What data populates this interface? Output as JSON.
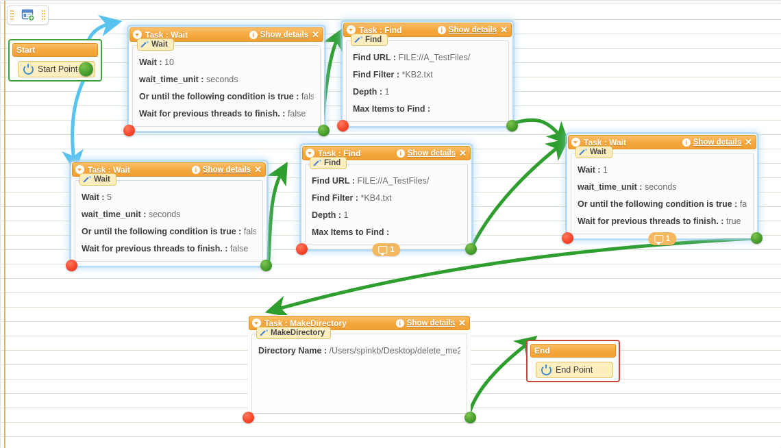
{
  "toolbar": {
    "add_task_icon": "add-form-icon",
    "grip_icon": "drag-grip-icon"
  },
  "nodes": {
    "start": {
      "title": "Start",
      "button_label": "Start Point",
      "power_icon": "power-icon"
    },
    "end": {
      "title": "End",
      "button_label": "End Point",
      "power_icon": "power-icon"
    }
  },
  "common": {
    "show_details": "Show details",
    "info_icon": "info-icon",
    "close_icon": "close-icon",
    "collapse_icon": "collapse-chevron-icon",
    "wand_icon": "wand-icon",
    "comment_icon": "comment-bubble-icon"
  },
  "tasks": [
    {
      "id": "wait-10",
      "header": "Task : Wait",
      "type_tab": "Wait",
      "rows": [
        {
          "label": "Wait :",
          "value": "10"
        },
        {
          "label": "wait_time_unit :",
          "value": "seconds"
        },
        {
          "label": "Or until the following condition is true :",
          "value": "false"
        },
        {
          "label": "Wait for previous threads to finish. :",
          "value": "false"
        }
      ],
      "badge": null
    },
    {
      "id": "find-kb2",
      "header": "Task : Find",
      "type_tab": "Find",
      "rows": [
        {
          "label": "Find URL :",
          "value": "FILE://A_TestFiles/"
        },
        {
          "label": "Find Filter :",
          "value": "*KB2.txt"
        },
        {
          "label": "Depth :",
          "value": "1"
        },
        {
          "label": "Max Items to Find :",
          "value": ""
        }
      ],
      "badge": null
    },
    {
      "id": "wait-5",
      "header": "Task : Wait",
      "type_tab": "Wait",
      "rows": [
        {
          "label": "Wait :",
          "value": "5"
        },
        {
          "label": "wait_time_unit :",
          "value": "seconds"
        },
        {
          "label": "Or until the following condition is true :",
          "value": "false"
        },
        {
          "label": "Wait for previous threads to finish. :",
          "value": "false"
        }
      ],
      "badge": null
    },
    {
      "id": "find-kb4",
      "header": "Task : Find",
      "type_tab": "Find",
      "rows": [
        {
          "label": "Find URL :",
          "value": "FILE://A_TestFiles/"
        },
        {
          "label": "Find Filter :",
          "value": "*KB4.txt"
        },
        {
          "label": "Depth :",
          "value": "1"
        },
        {
          "label": "Max Items to Find :",
          "value": ""
        }
      ],
      "badge": "1"
    },
    {
      "id": "wait-1",
      "header": "Task : Wait",
      "type_tab": "Wait",
      "rows": [
        {
          "label": "Wait :",
          "value": "1"
        },
        {
          "label": "wait_time_unit :",
          "value": "seconds"
        },
        {
          "label": "Or until the following condition is true :",
          "value": "false"
        },
        {
          "label": "Wait for previous threads to finish. :",
          "value": "true"
        }
      ],
      "badge": "1"
    },
    {
      "id": "makedirectory",
      "header": "Task : MakeDirectory",
      "type_tab": "MakeDirectory",
      "rows": [
        {
          "label": "Directory Name :",
          "value": "/Users/spinkb/Desktop/delete_me2"
        }
      ],
      "badge": null
    }
  ],
  "colors": {
    "header_orange": "#f5a83e",
    "type_tab_yellow": "#fdeec0",
    "start_border_green": "#3fa43f",
    "end_border_red": "#c9453c",
    "wire_green": "#2e9f2e",
    "wire_blue": "#59c3ef",
    "dot_red": "#f6472b",
    "dot_green": "#449b2c",
    "badge_orange": "#f4b860",
    "rule_line": "#d6e5d2",
    "margin_rule": "#f0a52e"
  }
}
